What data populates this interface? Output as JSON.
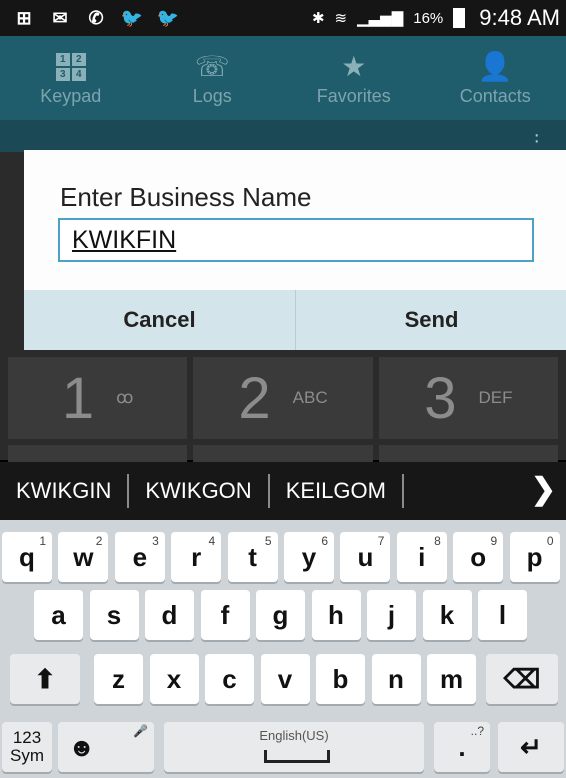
{
  "status_bar": {
    "left_icons": [
      "plus-box-icon",
      "mail-icon",
      "whatsapp-icon",
      "twitter-icon",
      "twitter-icon"
    ],
    "battery": "16%",
    "time": "9:48 AM"
  },
  "tabs": [
    {
      "label": "Keypad",
      "icon": "keypad-icon",
      "keypad_digits": [
        "1",
        "2",
        "3",
        "4"
      ]
    },
    {
      "label": "Logs",
      "icon": "call-log-icon"
    },
    {
      "label": "Favorites",
      "icon": "star-icon"
    },
    {
      "label": "Contacts",
      "icon": "contact-icon"
    }
  ],
  "dialpad": [
    {
      "digit": "1",
      "letters": "ꝏ"
    },
    {
      "digit": "2",
      "letters": "ABC"
    },
    {
      "digit": "3",
      "letters": "DEF"
    }
  ],
  "dialog": {
    "title": "Enter Business Name",
    "input_value": "KWIKFIN",
    "cancel_label": "Cancel",
    "send_label": "Send"
  },
  "suggestions": [
    "KWIKGIN",
    "KWIKGON",
    "KEILGOM"
  ],
  "keyboard": {
    "row1": [
      {
        "k": "q",
        "s": "1"
      },
      {
        "k": "w",
        "s": "2"
      },
      {
        "k": "e",
        "s": "3"
      },
      {
        "k": "r",
        "s": "4"
      },
      {
        "k": "t",
        "s": "5"
      },
      {
        "k": "y",
        "s": "6"
      },
      {
        "k": "u",
        "s": "7"
      },
      {
        "k": "i",
        "s": "8"
      },
      {
        "k": "o",
        "s": "9"
      },
      {
        "k": "p",
        "s": "0"
      }
    ],
    "row2": [
      "a",
      "s",
      "d",
      "f",
      "g",
      "h",
      "j",
      "k",
      "l"
    ],
    "row3": [
      "z",
      "x",
      "c",
      "v",
      "b",
      "n",
      "m"
    ],
    "sym_label_1": "123",
    "sym_label_2": "Sym",
    "language": "English(US)",
    "period": ".",
    "period_sup": "..?"
  }
}
